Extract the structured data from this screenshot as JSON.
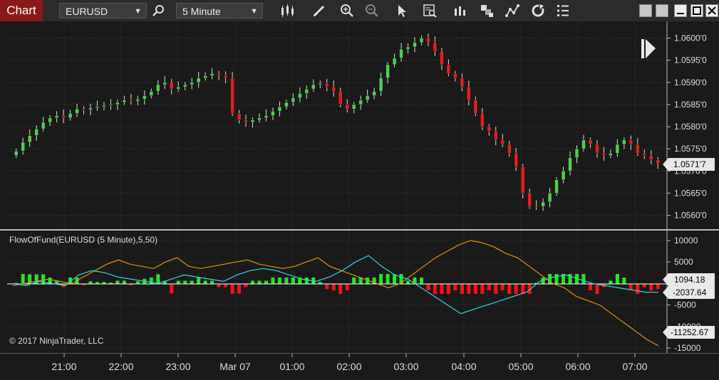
{
  "toolbar": {
    "tab_label": "Chart",
    "instrument": "EURUSD",
    "timeframe": "5 Minute",
    "icons": [
      "search-icon",
      "bar-type-icon",
      "pencil-icon",
      "zoom-in-icon",
      "zoom-out-icon",
      "pointer-icon",
      "data-box-icon",
      "bar-spacing-icon",
      "chart-style-icon",
      "drawing-tools-icon",
      "refresh-icon",
      "properties-icon"
    ],
    "window_buttons": [
      "restore-icon",
      "restore2-icon",
      "minimize-icon",
      "maximize-icon",
      "close-icon"
    ]
  },
  "price_axis": {
    "ticks": [
      "1.0600'0",
      "1.0595'0",
      "1.0590'0",
      "1.0585'0",
      "1.0580'0",
      "1.0575'0",
      "1.0570'0",
      "1.0565'0",
      "1.0560'0"
    ],
    "current_price": "1.0571'7"
  },
  "indicator": {
    "label": "FlowOfFund(EURUSD (5 Minute),5,50)",
    "ticks": [
      "10000",
      "5000",
      "-5000",
      "-10000",
      "-15000"
    ],
    "value_1": "1094.18",
    "value_2": "-2037.64",
    "value_3": "-11252.67"
  },
  "copyright": "© 2017 NinjaTrader, LLC",
  "time_axis": {
    "ticks": [
      "21:00",
      "22:00",
      "23:00",
      "Mar 07",
      "01:00",
      "02:00",
      "03:00",
      "04:00",
      "05:00",
      "06:00",
      "07:00"
    ]
  },
  "colors": {
    "up": "#4fd04f",
    "down": "#e02020",
    "orange_line": "#e8900a",
    "cyan_line": "#2fd6e8",
    "grid": "#3a3a3a"
  },
  "chart_data": {
    "type": "candlestick",
    "price_series_closes": [
      1.05745,
      1.05765,
      1.0578,
      1.05795,
      1.0581,
      1.0582,
      1.05825,
      1.0582,
      1.0583,
      1.0584,
      1.05838,
      1.05842,
      1.05845,
      1.05848,
      1.0585,
      1.05855,
      1.0586,
      1.05858,
      1.05862,
      1.0587,
      1.0588,
      1.05895,
      1.059,
      1.05885,
      1.0589,
      1.05895,
      1.059,
      1.0591,
      1.05915,
      1.0592,
      1.05915,
      1.0591,
      1.0583,
      1.05815,
      1.0581,
      1.05815,
      1.0582,
      1.05825,
      1.05835,
      1.05845,
      1.05855,
      1.05865,
      1.05875,
      1.05885,
      1.05895,
      1.05898,
      1.0589,
      1.0588,
      1.0585,
      1.0584,
      1.0585,
      1.0586,
      1.0587,
      1.0588,
      1.0591,
      1.0594,
      1.05955,
      1.05975,
      1.0598,
      1.0599,
      1.06,
      1.0599,
      1.0597,
      1.0594,
      1.0592,
      1.0591,
      1.0589,
      1.0586,
      1.0583,
      1.058,
      1.0579,
      1.0577,
      1.0576,
      1.0574,
      1.0571,
      1.0565,
      1.0562,
      1.0562,
      1.0563,
      1.0565,
      1.0568,
      1.057,
      1.0573,
      1.0575,
      1.0577,
      1.0576,
      1.0574,
      1.05735,
      1.0574,
      1.0576,
      1.0577,
      1.0576,
      1.0574,
      1.05735,
      1.05725,
      1.05717
    ],
    "flow_of_fund_orange": [
      -500,
      0,
      500,
      1000,
      500,
      0,
      1500,
      3000,
      4500,
      5500,
      4500,
      4000,
      3500,
      5000,
      6000,
      4000,
      3500,
      4000,
      4500,
      5000,
      5500,
      4500,
      4000,
      3500,
      4000,
      5000,
      6000,
      4000,
      3000,
      2000,
      1000,
      0,
      -1000,
      0,
      2000,
      4000,
      6000,
      7500,
      9000,
      10000,
      9500,
      8500,
      7000,
      6000,
      4000,
      2000,
      0,
      -1000,
      -3000,
      -4000,
      -5000,
      -7000,
      -9000,
      -11000,
      -13000,
      -14500
    ],
    "flow_of_fund_cyan": [
      0,
      -500,
      500,
      0,
      -500,
      2000,
      3000,
      2500,
      1500,
      1000,
      500,
      0,
      1000,
      2000,
      1500,
      1000,
      500,
      2000,
      3000,
      3500,
      3000,
      2000,
      1000,
      500,
      1500,
      3000,
      5000,
      6500,
      4000,
      2000,
      1000,
      -1000,
      -3000,
      -5000,
      -7000,
      -6000,
      -5000,
      -4000,
      -3000,
      -2000,
      500,
      1500,
      2000,
      1000,
      0,
      -500,
      -1000,
      -1500,
      -2000,
      -2037.64
    ],
    "ylim_price": [
      1.0558,
      1.06025
    ],
    "ylim_indicator": [
      -15500,
      11500
    ]
  }
}
